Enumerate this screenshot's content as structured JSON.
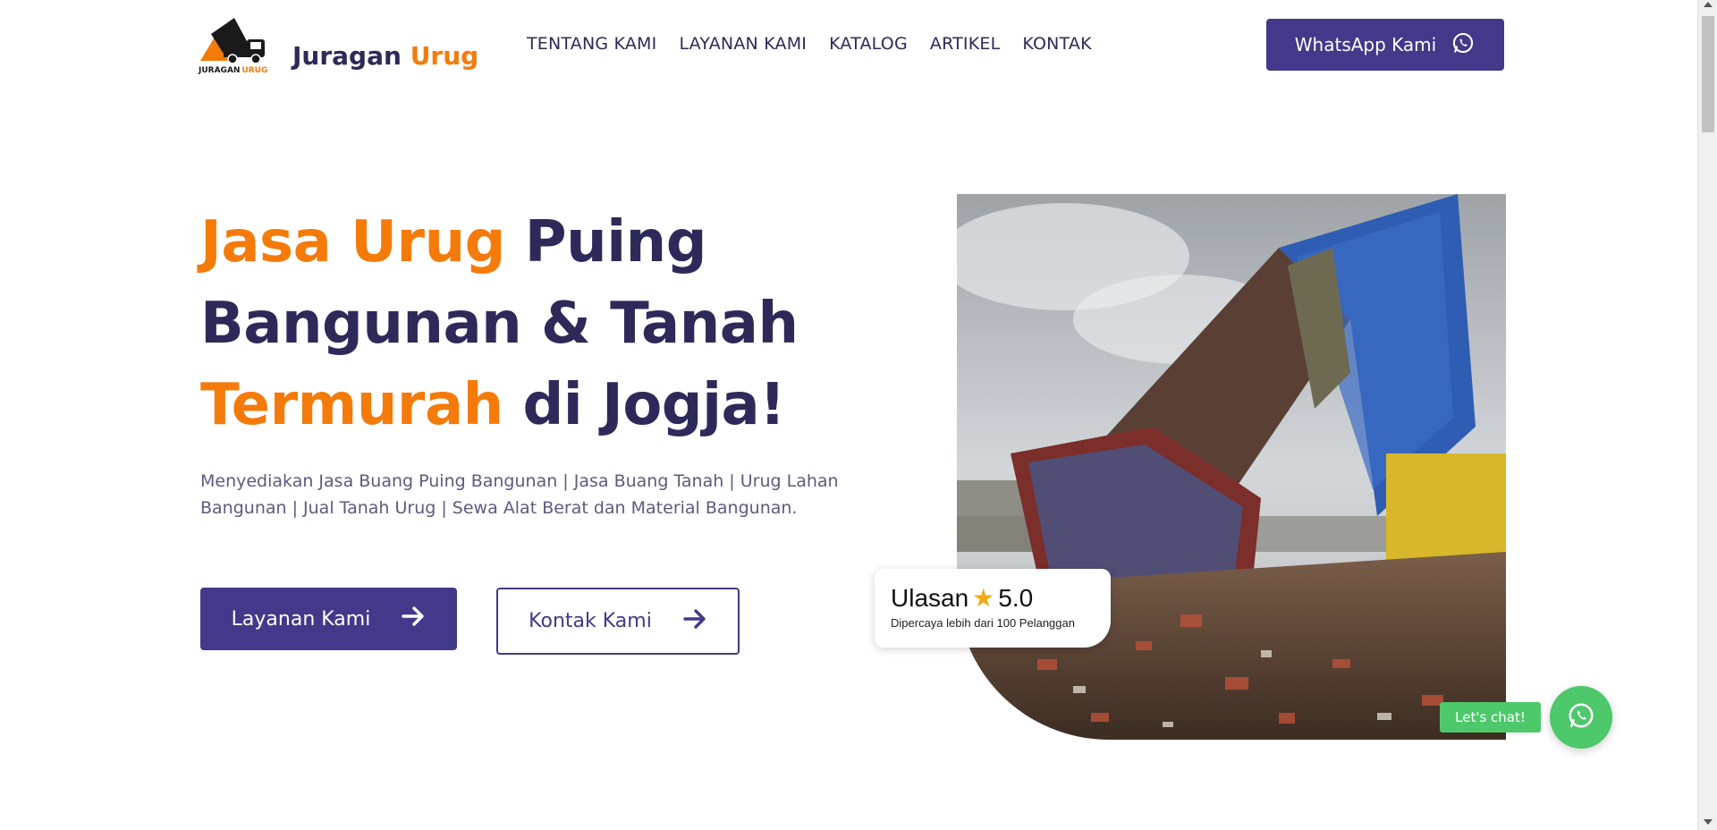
{
  "brand": {
    "name_part1": "Juragan",
    "name_part2": "Urug",
    "logo_caption_part1": "JURAGAN",
    "logo_caption_part2": "URUG",
    "primary_color": "#42398a",
    "accent_color": "#f47b0a",
    "dark_text_color": "#2d2a5a"
  },
  "nav": {
    "items": [
      {
        "label": "TENTANG KAMI"
      },
      {
        "label": "LAYANAN KAMI"
      },
      {
        "label": "KATALOG"
      },
      {
        "label": "ARTIKEL"
      },
      {
        "label": "KONTAK"
      }
    ],
    "cta_label": "WhatsApp Kami",
    "cta_icon": "whatsapp-icon"
  },
  "hero": {
    "title_1": "Jasa Urug",
    "title_2": " Puing",
    "title_3": "Bangunan & Tanah",
    "title_4": "Termurah",
    "title_5": " di Jogja!",
    "subtitle": "Menyediakan Jasa Buang Puing Bangunan | Jasa Buang Tanah | Urug Lahan Bangunan | Jual Tanah Urug | Sewa Alat Berat dan Material Bangunan.",
    "primary_button": "Layanan Kami",
    "secondary_button": "Kontak Kami",
    "button_icon": "arrow-right-icon"
  },
  "review": {
    "label": "Ulasan",
    "rating": "5.0",
    "rating_value": 5.0,
    "caption": "Dipercaya lebih dari 100 Pelanggan",
    "star_color": "#f2a81a"
  },
  "chat": {
    "label": "Let's chat!",
    "color": "#4dc86a",
    "icon": "whatsapp-icon"
  }
}
